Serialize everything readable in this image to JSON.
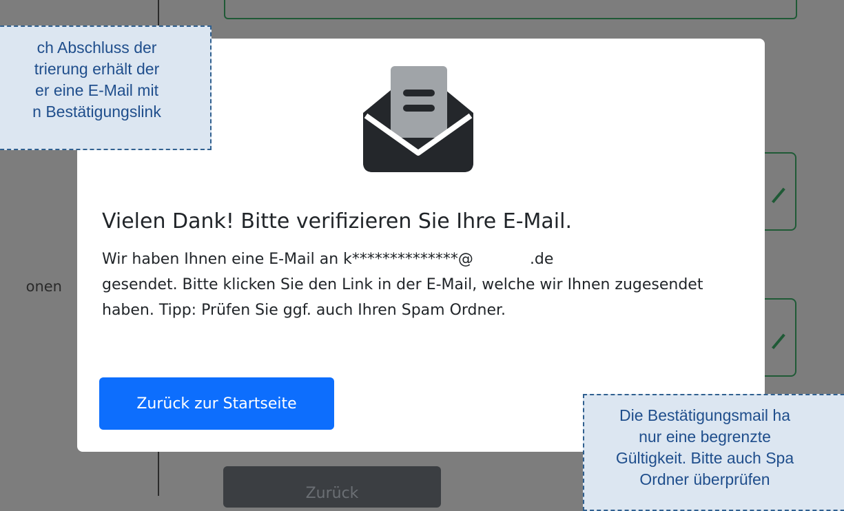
{
  "background": {
    "side_label": "onen",
    "back_button_label": "Zurück"
  },
  "modal": {
    "icon": "envelope-open-icon",
    "title": "Vielen Dank! Bitte verifizieren Sie Ihre E-Mail.",
    "message_part1": "Wir haben Ihnen eine E-Mail an k**************@",
    "message_part2": ".de",
    "message_part3": "gesendet. Bitte klicken Sie den Link in der E-Mail, welche wir Ihnen zugesendet haben. Tipp: Prüfen Sie ggf. auch Ihren Spam Ordner.",
    "button_label": "Zurück zur Startseite",
    "colors": {
      "primary": "#0d6efd",
      "text": "#212529",
      "icon": "#24272b",
      "icon_paper": "#a0a4a8"
    }
  },
  "annotations": {
    "left": "ch Abschluss der\ntrierung erhält der\ner eine E-Mail mit\nn Bestätigungslink",
    "right": "Die Bestätigungsmail ha\nnur eine begrenzte\nGültigkeit. Bitte auch Spa\nOrdner überprüfen"
  }
}
